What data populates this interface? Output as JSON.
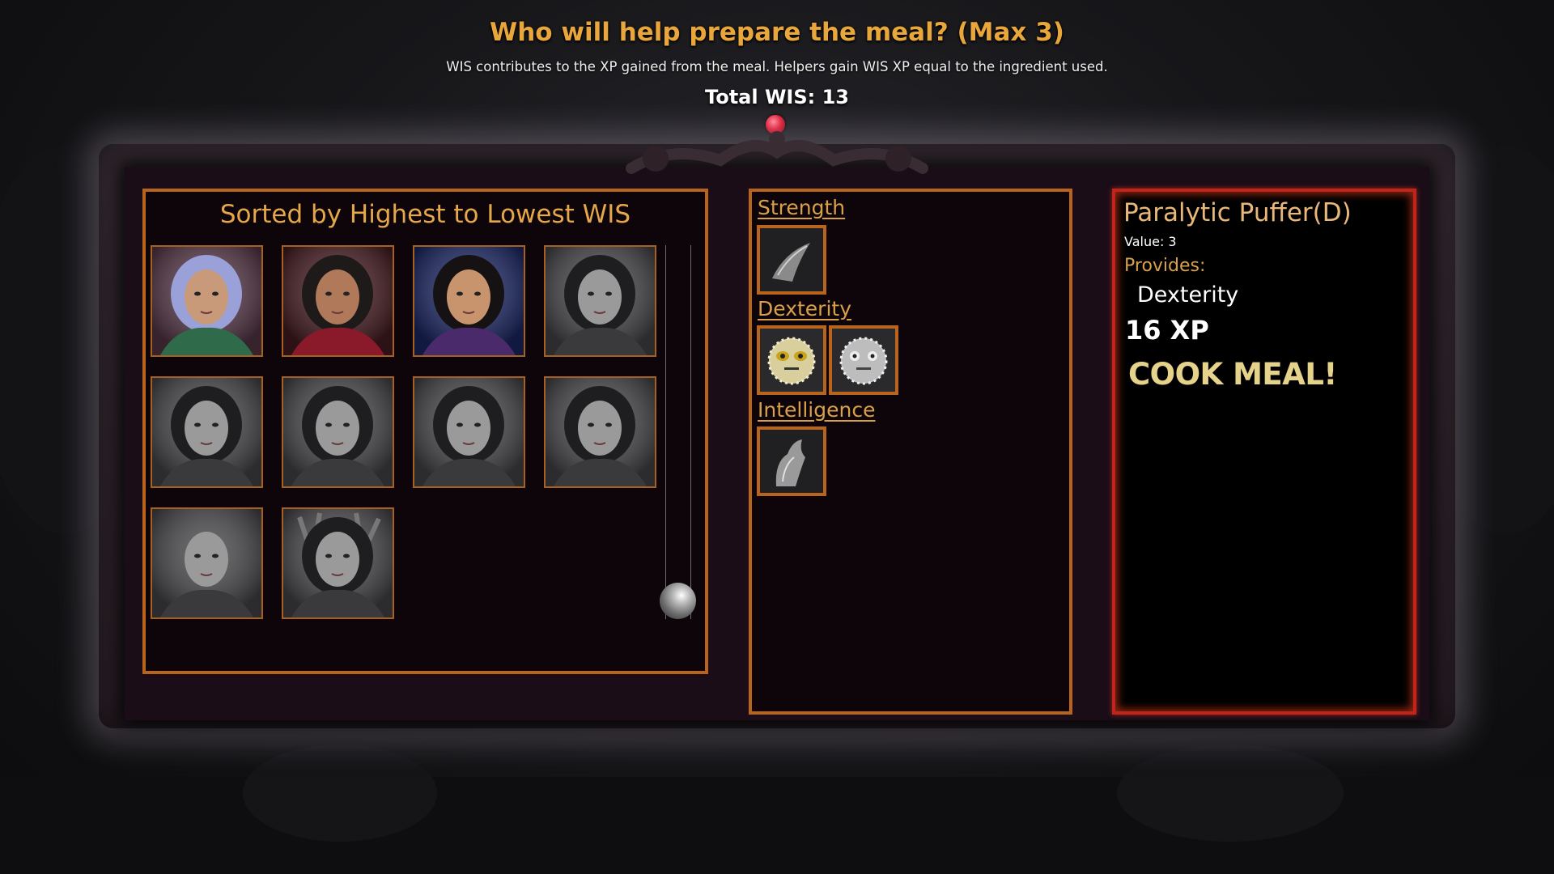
{
  "header": {
    "title": "Who will help prepare the meal? (Max 3)",
    "subtitle": "WIS contributes to the XP gained from the meal. Helpers gain WIS XP equal to the ingredient used.",
    "total_wis": "Total WIS: 13"
  },
  "roster": {
    "heading": "Sorted by Highest to Lowest WIS",
    "portraits": [
      {
        "name": "silver-haired-elf-portrait",
        "colored": true
      },
      {
        "name": "bearded-man-portrait",
        "colored": true
      },
      {
        "name": "dark-haired-woman-portrait",
        "colored": true
      },
      {
        "name": "headband-woman-portrait",
        "colored": false
      },
      {
        "name": "hooded-woman-portrait",
        "colored": false
      },
      {
        "name": "braided-woman-portrait",
        "colored": false
      },
      {
        "name": "curly-haired-woman-portrait",
        "colored": false
      },
      {
        "name": "short-haired-woman-portrait",
        "colored": false
      },
      {
        "name": "bald-man-portrait",
        "colored": false
      },
      {
        "name": "antlered-creature-portrait",
        "colored": false
      }
    ]
  },
  "ingredients": {
    "categories": [
      {
        "label": "Strength",
        "items": [
          "claw-icon"
        ]
      },
      {
        "label": "Dexterity",
        "items": [
          "pufferfish-icon",
          "pufferfish-icon"
        ]
      },
      {
        "label": "Intelligence",
        "items": [
          "tentacle-icon"
        ]
      }
    ]
  },
  "detail": {
    "dish_name": "Paralytic Puffer(D)",
    "value": "Value: 3",
    "provides_label": "Provides:",
    "provides_stat": "Dexterity",
    "xp": "16 XP",
    "cook_button": "COOK MEAL!"
  },
  "colors": {
    "title": "#e9a63b",
    "panel_border": "#b8641c",
    "detail_border": "#c2241c",
    "accent_text": "#d9a04a",
    "cook_button": "#e6d38b"
  }
}
